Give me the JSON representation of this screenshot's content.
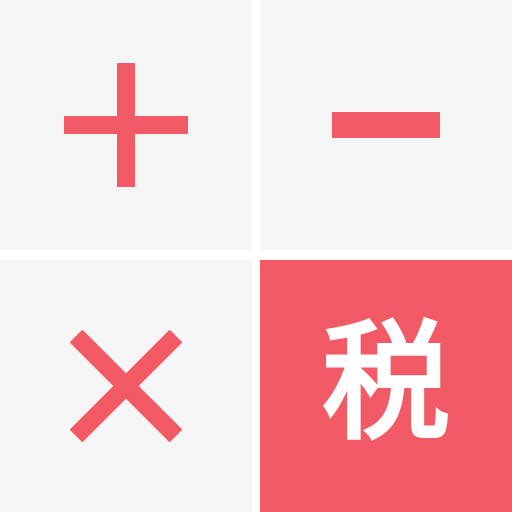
{
  "colors": {
    "tile_background": "#f6f6f6",
    "accent": "#f25a65",
    "gap": "#ffffff",
    "tax_text": "#ffffff"
  },
  "tiles": [
    {
      "icon": "plus-icon"
    },
    {
      "icon": "minus-icon"
    },
    {
      "icon": "multiply-icon"
    },
    {
      "label": "税"
    }
  ]
}
